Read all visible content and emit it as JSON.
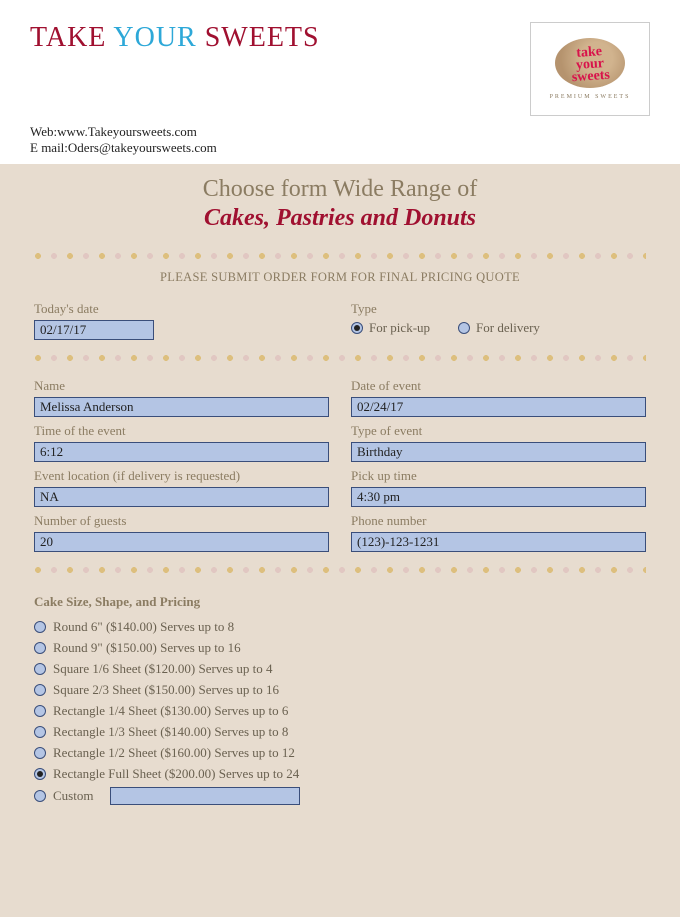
{
  "brand": {
    "w1": "TAKE",
    "w2": "YOUR",
    "w3": "SWEETS"
  },
  "contact": {
    "web_label": "Web:",
    "web": "www.Takeyoursweets.com",
    "email_label": "E mail:",
    "email": "Oders@takeyoursweets.com"
  },
  "logo": {
    "script": "take your sweets",
    "tag": "PREMIUM SWEETS"
  },
  "hero": {
    "line1": "Choose form Wide Range of",
    "line2": "Cakes, Pastries and Donuts"
  },
  "instruction": "PLEASE SUBMIT ORDER FORM FOR FINAL PRICING QUOTE",
  "fields": {
    "date_label": "Today's date",
    "date_value": "02/17/17",
    "type_label": "Type",
    "type_pickup": "For pick-up",
    "type_delivery": "For delivery",
    "type_selected": "pickup",
    "name_label": "Name",
    "name_value": "Melissa Anderson",
    "doe_label": "Date of event",
    "doe_value": "02/24/17",
    "time_label": "Time of the event",
    "time_value": "6:12",
    "etype_label": "Type of event",
    "etype_value": "Birthday",
    "loc_label": "Event location (if delivery is requested)",
    "loc_value": "NA",
    "puptime_label": "Pick up time",
    "puptime_value": "4:30 pm",
    "guests_label": "Number of guests",
    "guests_value": "20",
    "phone_label": "Phone number",
    "phone_value": "(123)-123-1231"
  },
  "cakes": {
    "heading": "Cake Size, Shape, and Pricing",
    "selected_index": 7,
    "options": [
      "Round 6\" ($140.00) Serves up to 8",
      "Round 9\" ($150.00) Serves up to 16",
      "Square 1/6 Sheet ($120.00) Serves up to 4",
      "Square 2/3 Sheet ($150.00) Serves up to 16",
      "Rectangle 1/4 Sheet ($130.00) Serves up to 6",
      "Rectangle 1/3 Sheet ($140.00) Serves up to 8",
      "Rectangle 1/2 Sheet ($160.00) Serves up to 12",
      "Rectangle Full Sheet ($200.00) Serves up to 24",
      "Custom"
    ]
  }
}
